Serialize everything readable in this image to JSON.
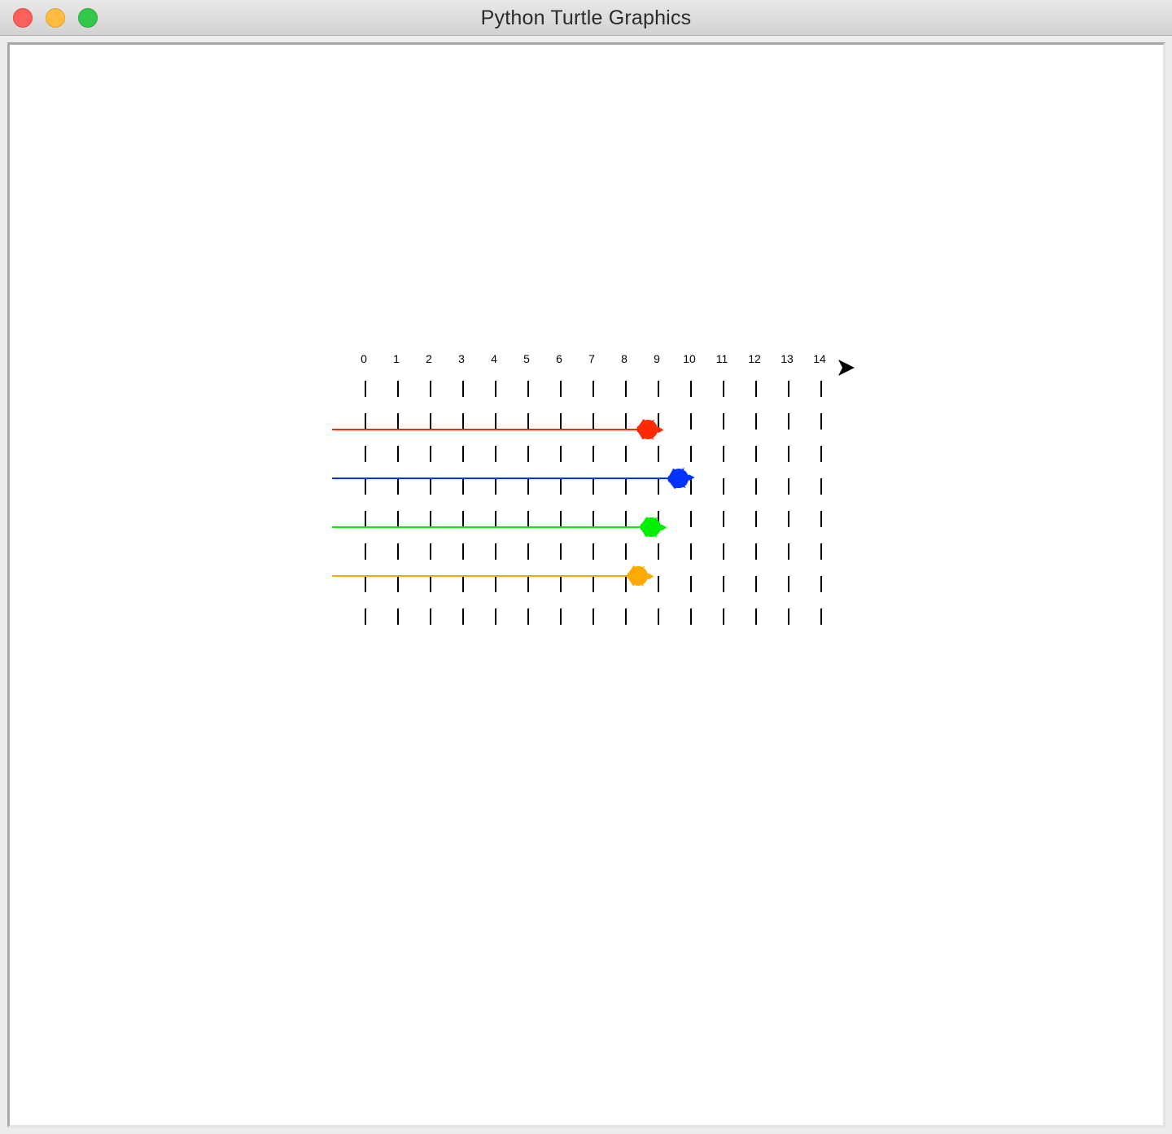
{
  "window": {
    "title": "Python Turtle Graphics",
    "controls": [
      "close-icon",
      "minimize-icon",
      "zoom-icon"
    ],
    "control_colors": {
      "close": "#fc605b",
      "minimize": "#fdbc40",
      "zoom": "#34c84a"
    }
  },
  "canvas": {
    "background": "#ffffff",
    "track_labels": [
      "0",
      "1",
      "2",
      "3",
      "4",
      "5",
      "6",
      "7",
      "8",
      "9",
      "10",
      "11",
      "12",
      "13",
      "14"
    ],
    "pointer_turtle": {
      "shape": "arrow-icon",
      "color": "#000000"
    },
    "racers": [
      {
        "color": "#ff2a00",
        "shape": "turtle-icon",
        "position": 8.7
      },
      {
        "color": "#0033ff",
        "shape": "turtle-icon",
        "position": 9.65
      },
      {
        "color": "#00ee00",
        "shape": "turtle-icon",
        "position": 8.8
      },
      {
        "color": "#ffaa00",
        "shape": "turtle-icon",
        "position": 8.4
      }
    ]
  }
}
